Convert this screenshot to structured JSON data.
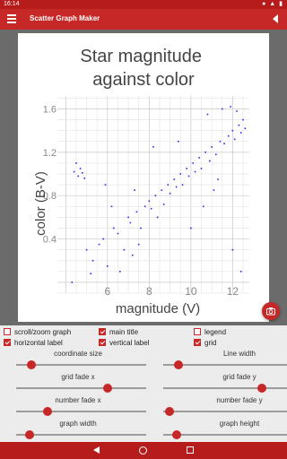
{
  "status_bar": {
    "time": "16:14"
  },
  "app_bar": {
    "title": "Scatter Graph Maker"
  },
  "chart_data": {
    "type": "scatter",
    "title": "Star magnitude against color",
    "xlabel": "magnitude (V)",
    "ylabel": "color (B-V)",
    "xlim": [
      3.6,
      12.8
    ],
    "ylim": [
      -0.1,
      1.72
    ],
    "x_ticks": [
      "6",
      "8",
      "10",
      "12"
    ],
    "y_ticks": [
      "0.4",
      "0.8",
      "1.2",
      "1.6"
    ],
    "grid": true,
    "legend": false,
    "point_color": "#2a2af0",
    "points": [
      [
        4.4,
        1.02
      ],
      [
        4.6,
        0.98
      ],
      [
        4.7,
        1.05
      ],
      [
        4.5,
        1.1
      ],
      [
        4.8,
        1.01
      ],
      [
        4.9,
        0.96
      ],
      [
        4.3,
        0.0
      ],
      [
        5.0,
        0.3
      ],
      [
        5.3,
        0.2
      ],
      [
        5.6,
        0.35
      ],
      [
        5.8,
        0.4
      ],
      [
        5.2,
        0.08
      ],
      [
        6.0,
        0.15
      ],
      [
        6.3,
        0.5
      ],
      [
        6.5,
        0.45
      ],
      [
        5.9,
        0.9
      ],
      [
        6.6,
        0.1
      ],
      [
        6.8,
        0.3
      ],
      [
        7.0,
        0.6
      ],
      [
        7.1,
        0.55
      ],
      [
        7.2,
        0.25
      ],
      [
        7.4,
        0.65
      ],
      [
        7.6,
        0.5
      ],
      [
        7.5,
        0.35
      ],
      [
        7.8,
        0.7
      ],
      [
        8.0,
        0.75
      ],
      [
        8.1,
        0.68
      ],
      [
        8.3,
        0.8
      ],
      [
        8.4,
        0.6
      ],
      [
        8.6,
        0.85
      ],
      [
        8.7,
        0.72
      ],
      [
        8.9,
        0.9
      ],
      [
        9.0,
        0.82
      ],
      [
        9.2,
        0.95
      ],
      [
        9.3,
        0.88
      ],
      [
        9.5,
        1.0
      ],
      [
        9.6,
        0.9
      ],
      [
        9.8,
        1.05
      ],
      [
        9.9,
        0.98
      ],
      [
        10.1,
        1.1
      ],
      [
        10.2,
        1.02
      ],
      [
        10.4,
        1.15
      ],
      [
        10.5,
        1.05
      ],
      [
        10.7,
        1.2
      ],
      [
        10.9,
        1.12
      ],
      [
        11.0,
        1.25
      ],
      [
        11.2,
        1.18
      ],
      [
        11.4,
        1.3
      ],
      [
        11.6,
        1.28
      ],
      [
        11.8,
        1.35
      ],
      [
        12.0,
        1.4
      ],
      [
        12.1,
        1.32
      ],
      [
        12.3,
        1.45
      ],
      [
        12.4,
        1.38
      ],
      [
        12.5,
        1.5
      ],
      [
        12.6,
        1.42
      ],
      [
        11.5,
        1.6
      ],
      [
        12.2,
        1.58
      ],
      [
        10.8,
        1.55
      ],
      [
        11.9,
        1.62
      ],
      [
        8.2,
        1.25
      ],
      [
        9.4,
        1.3
      ],
      [
        10.0,
        0.5
      ],
      [
        10.6,
        0.7
      ],
      [
        11.1,
        0.85
      ],
      [
        12.4,
        0.1
      ],
      [
        12.0,
        0.3
      ],
      [
        11.3,
        0.95
      ],
      [
        7.3,
        0.85
      ],
      [
        6.2,
        0.7
      ]
    ]
  },
  "controls": {
    "checkboxes": [
      {
        "label": "scroll/zoom graph",
        "checked": false
      },
      {
        "label": "main title",
        "checked": true
      },
      {
        "label": "legend",
        "checked": false
      },
      {
        "label": "horizontal label",
        "checked": true
      },
      {
        "label": "vertical label",
        "checked": true
      },
      {
        "label": "grid",
        "checked": true
      }
    ],
    "sliders": [
      {
        "label": "coordinate size",
        "value": 0.12
      },
      {
        "label": "Line width",
        "value": 0.12
      },
      {
        "label": "grid fade x",
        "value": 0.7
      },
      {
        "label": "grid fade y",
        "value": 0.76
      },
      {
        "label": "number fade x",
        "value": 0.24
      },
      {
        "label": "number fade y",
        "value": 0.05
      },
      {
        "label": "graph width",
        "value": 0.1
      },
      {
        "label": "graph height",
        "value": 0.1
      }
    ]
  }
}
